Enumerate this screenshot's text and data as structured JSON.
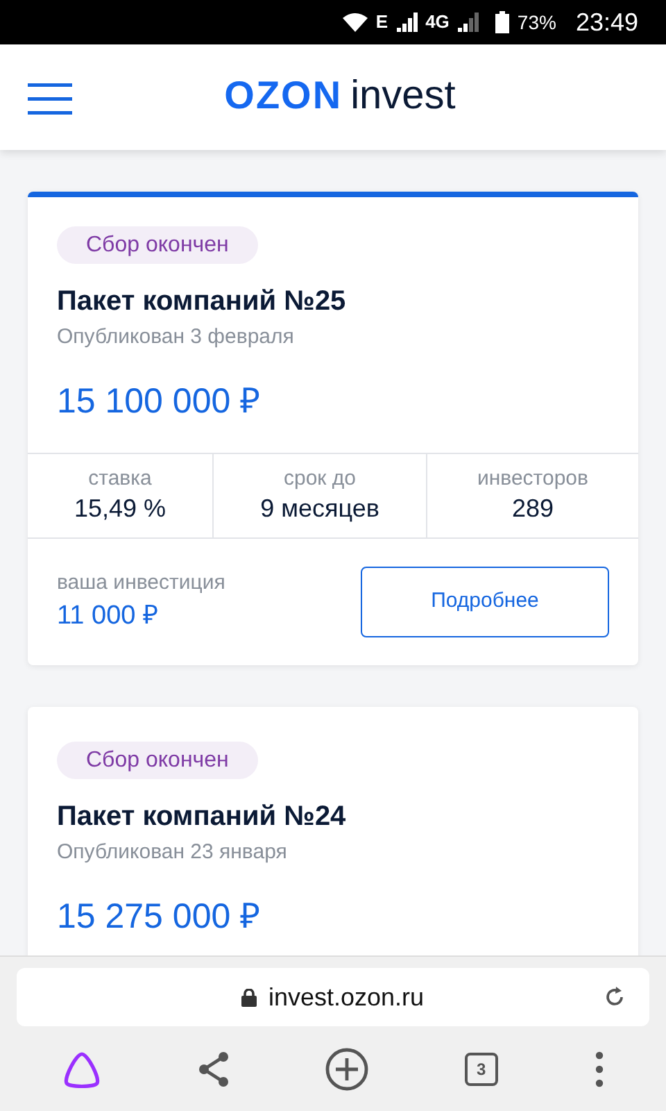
{
  "status_bar": {
    "network_1": "E",
    "network_2": "4G",
    "battery": "73%",
    "time": "23:49"
  },
  "header": {
    "logo_brand": "OZON",
    "logo_product": "invest"
  },
  "cards": [
    {
      "badge": "Сбор окончен",
      "title": "Пакет компаний №25",
      "published": "Опубликован 3 февраля",
      "amount": "15 100 000 ₽",
      "accent_top": true,
      "stats": [
        {
          "label": "ставка",
          "value": "15,49 %"
        },
        {
          "label": "срок до",
          "value": "9 месяцев"
        },
        {
          "label": "инвесторов",
          "value": "289"
        }
      ],
      "investment": {
        "label": "ваша инвестиция",
        "value": "11 000 ₽"
      },
      "button": "Подробнее"
    },
    {
      "badge": "Сбор окончен",
      "title": "Пакет компаний №24",
      "published": "Опубликован 23 января",
      "amount": "15 275 000 ₽",
      "accent_top": false
    }
  ],
  "browser": {
    "url": "invest.ozon.ru",
    "tab_count": "3"
  }
}
